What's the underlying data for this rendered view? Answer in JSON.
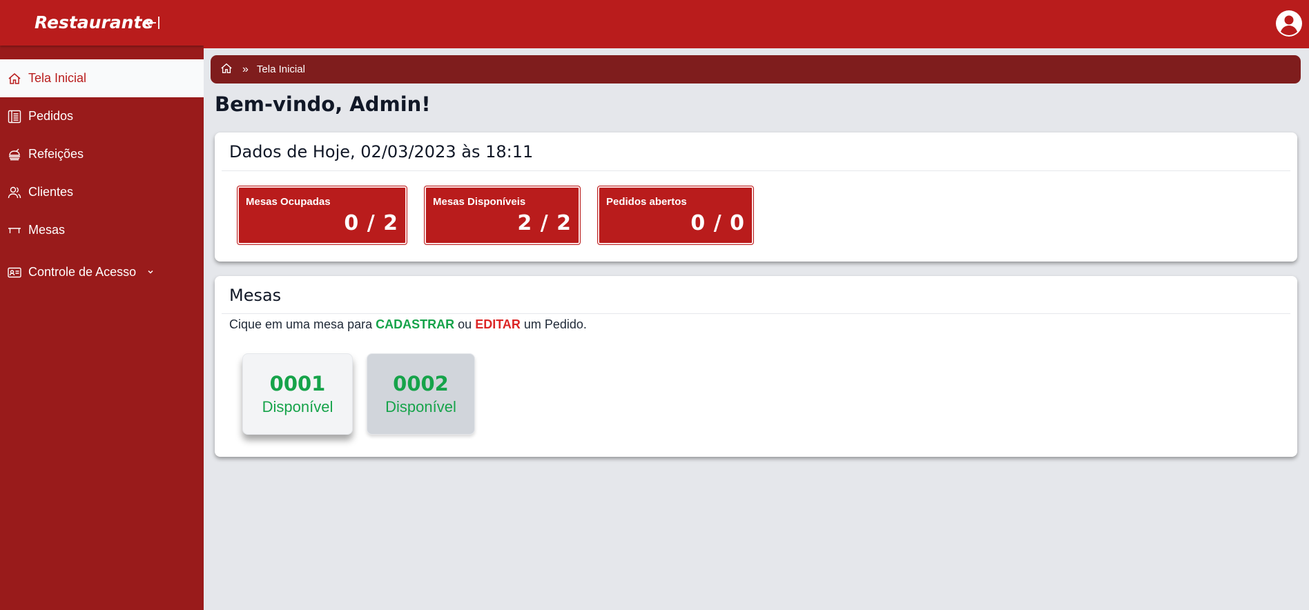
{
  "brand": {
    "title": "Restaurante"
  },
  "sidebar": {
    "items": [
      {
        "label": "Tela Inicial",
        "icon": "home-icon",
        "active": true
      },
      {
        "label": "Pedidos",
        "icon": "receipt-icon"
      },
      {
        "label": "Refeições",
        "icon": "meal-icon"
      },
      {
        "label": "Clientes",
        "icon": "users-icon"
      },
      {
        "label": "Mesas",
        "icon": "table-icon"
      },
      {
        "label": "Controle de Acesso",
        "icon": "id-card-icon",
        "has_submenu": true
      }
    ]
  },
  "breadcrumb": {
    "separator": "»",
    "current": "Tela Inicial"
  },
  "welcome": "Bem-vindo, Admin!",
  "today": {
    "title": "Dados de Hoje, 02/03/2023 às 18:11",
    "stats": [
      {
        "label": "Mesas Ocupadas",
        "value": "0 / 2"
      },
      {
        "label": "Mesas Disponíveis",
        "value": "2 / 2"
      },
      {
        "label": "Pedidos abertos",
        "value": "0 / 0"
      }
    ]
  },
  "mesas": {
    "title": "Mesas",
    "instructions": {
      "prefix": "Cique em uma mesa para",
      "cadastrar": "CADASTRAR",
      "middle": "ou",
      "editar": "EDITAR",
      "suffix": "um Pedido."
    },
    "tables": [
      {
        "number": "0001",
        "status": "Disponível"
      },
      {
        "number": "0002",
        "status": "Disponível"
      }
    ]
  },
  "colors": {
    "primary": "#b91c1c",
    "sidebar": "#991b1b",
    "breadcrumb": "#7f1d1d",
    "success": "#16a34a",
    "danger": "#dc2626",
    "background": "#e5e7eb"
  }
}
